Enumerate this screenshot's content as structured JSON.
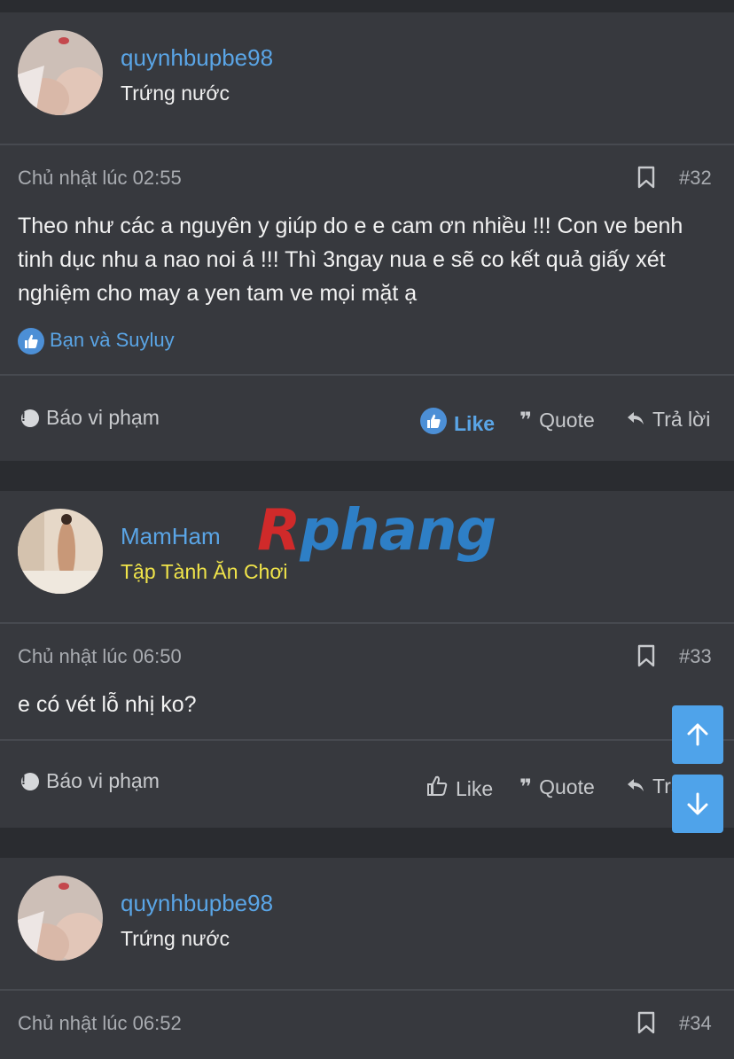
{
  "posts": [
    {
      "username": "quynhbupbe98",
      "user_title": "Trứng nước",
      "date": "Chủ nhật lúc 02:55",
      "post_number": "#32",
      "body": "Theo như các a nguyên y giúp do e e cam ơn nhiều !!! Con ve benh tinh dục nhu a nao noi á !!! Thì 3ngay nua e sẽ co kết quả giấy xét nghiệm cho may a yen tam ve mọi mặt ạ",
      "likes_text": "Bạn và Suyluy",
      "actions": {
        "report": "Báo vi phạm",
        "like": "Like",
        "quote": "Quote",
        "reply": "Trả lời"
      }
    },
    {
      "username": "MamHam",
      "user_title": "Tập Tành Ăn Chơi",
      "date": "Chủ nhật lúc 06:50",
      "post_number": "#33",
      "body": "e có vét lỗ nhị ko?",
      "actions": {
        "report": "Báo vi phạm",
        "like": "Like",
        "quote": "Quote",
        "reply": "Trả lời"
      }
    },
    {
      "username": "quynhbupbe98",
      "user_title": "Trứng nước",
      "date": "Chủ nhật lúc 06:52",
      "post_number": "#34"
    }
  ],
  "watermark": {
    "first_letter": "R",
    "rest": "phang"
  },
  "colors": {
    "accent": "#5aa5e6",
    "background": "#2a2c30",
    "card": "#37393e",
    "scroll_button": "#4fa3ea"
  },
  "icons": [
    "bookmark-icon",
    "report-icon",
    "like-icon",
    "quote-icon",
    "reply-icon",
    "arrow-up-icon",
    "arrow-down-icon"
  ]
}
